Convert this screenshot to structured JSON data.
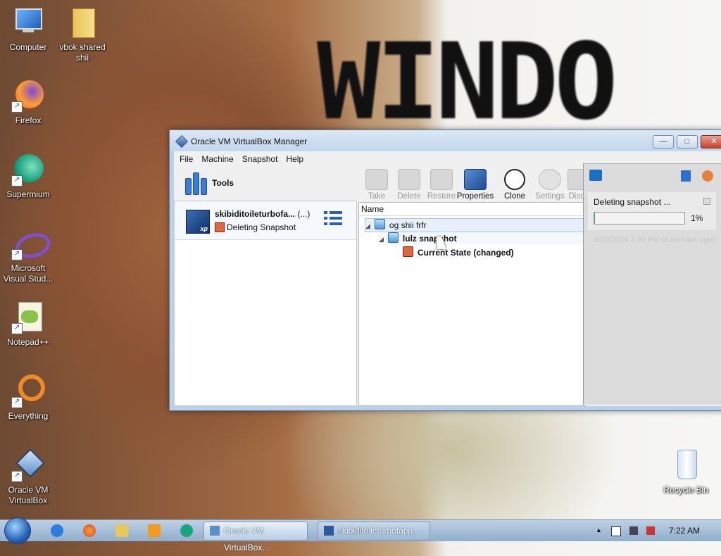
{
  "desktop": {
    "icons": [
      {
        "label": "Computer"
      },
      {
        "label": "vbok shared shii"
      },
      {
        "label": "Firefox"
      },
      {
        "label": "Supermium"
      },
      {
        "label": "Microsoft Visual Stud..."
      },
      {
        "label": "Notepad++"
      },
      {
        "label": "Everything"
      },
      {
        "label": "Oracle VM VirtualBox"
      },
      {
        "label": "Recycle Bin"
      }
    ],
    "wallpaper_text": "WINDO"
  },
  "window": {
    "title": "Oracle VM VirtualBox Manager",
    "controls": {
      "minimize": "—",
      "maximize": "□",
      "close": "✕"
    },
    "menu": [
      "File",
      "Machine",
      "Snapshot",
      "Help"
    ],
    "tools_label": "Tools",
    "vm": {
      "name": "skibiditoileturbofa...",
      "name_suffix": "(...)",
      "state": "Deleting Snapshot",
      "os_badge": "xp"
    },
    "toolbar": [
      {
        "label": "Take",
        "enabled": false
      },
      {
        "label": "Delete",
        "enabled": false
      },
      {
        "label": "Restore",
        "enabled": false
      },
      {
        "label": "Properties",
        "enabled": true
      },
      {
        "label": "Clone",
        "enabled": true
      },
      {
        "label": "Settings",
        "enabled": false
      },
      {
        "label": "Disca",
        "enabled": false
      }
    ],
    "tree": {
      "column_header": "Name",
      "nodes": [
        {
          "label": "og shii frfr"
        },
        {
          "label": "lulz snapshot"
        },
        {
          "label": "Current State (changed)"
        }
      ]
    }
  },
  "notification": {
    "text": "Deleting snapshot ...",
    "progress_percent": 1,
    "progress_label": "1%",
    "faded_timestamp": "8/12/2024 7:20 PM (3 minutes ago)"
  },
  "taskbar": {
    "buttons": [
      {
        "label": "Oracle VM VirtualBox..."
      },
      {
        "label": "skibiditoileturbofapp..."
      }
    ],
    "clock": "7:22 AM",
    "tray_arrow": "▲"
  },
  "colors": {
    "progress_fill": "#35c04a",
    "taskbar": "#a7bfd8",
    "titlebar": "#c2d6ec"
  }
}
